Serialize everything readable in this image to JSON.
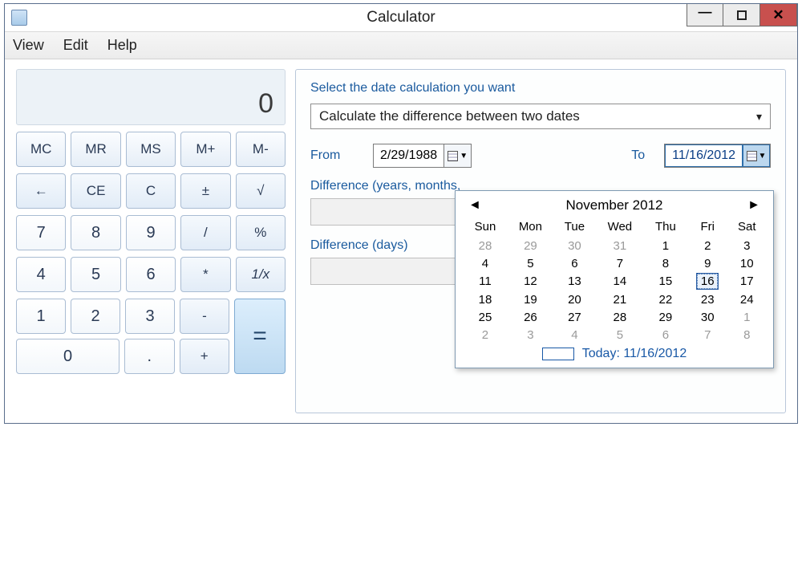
{
  "window": {
    "title": "Calculator"
  },
  "menu": {
    "view": "View",
    "edit": "Edit",
    "help": "Help"
  },
  "calc": {
    "display": "0",
    "mc": "MC",
    "mr": "MR",
    "ms": "MS",
    "mplus": "M+",
    "mminus": "M-",
    "back": "←",
    "ce": "CE",
    "c": "C",
    "pm": "±",
    "sqrt": "√",
    "n7": "7",
    "n8": "8",
    "n9": "9",
    "div": "/",
    "pct": "%",
    "n4": "4",
    "n5": "5",
    "n6": "6",
    "mul": "*",
    "inv": "1/x",
    "n1": "1",
    "n2": "2",
    "n3": "3",
    "sub": "-",
    "eq": "=",
    "n0": "0",
    "dot": ".",
    "add": "+"
  },
  "datecalc": {
    "prompt": "Select the date calculation you want",
    "mode": "Calculate the difference between two dates",
    "from_lbl": "From",
    "to_lbl": "To",
    "from_val": "2/29/1988",
    "to_val": "11/16/2012",
    "diff_ymwd_lbl": "Difference (years, months,",
    "diff_days_lbl": "Difference (days)"
  },
  "calendar": {
    "title": "November 2012",
    "dow": [
      "Sun",
      "Mon",
      "Tue",
      "Wed",
      "Thu",
      "Fri",
      "Sat"
    ],
    "weeks": [
      [
        {
          "d": "28",
          "o": true
        },
        {
          "d": "29",
          "o": true
        },
        {
          "d": "30",
          "o": true
        },
        {
          "d": "31",
          "o": true
        },
        {
          "d": "1"
        },
        {
          "d": "2"
        },
        {
          "d": "3"
        }
      ],
      [
        {
          "d": "4"
        },
        {
          "d": "5"
        },
        {
          "d": "6"
        },
        {
          "d": "7"
        },
        {
          "d": "8"
        },
        {
          "d": "9"
        },
        {
          "d": "10"
        }
      ],
      [
        {
          "d": "11"
        },
        {
          "d": "12"
        },
        {
          "d": "13"
        },
        {
          "d": "14"
        },
        {
          "d": "15"
        },
        {
          "d": "16",
          "sel": true
        },
        {
          "d": "17"
        }
      ],
      [
        {
          "d": "18"
        },
        {
          "d": "19"
        },
        {
          "d": "20"
        },
        {
          "d": "21"
        },
        {
          "d": "22"
        },
        {
          "d": "23"
        },
        {
          "d": "24"
        }
      ],
      [
        {
          "d": "25"
        },
        {
          "d": "26"
        },
        {
          "d": "27"
        },
        {
          "d": "28"
        },
        {
          "d": "29"
        },
        {
          "d": "30"
        },
        {
          "d": "1",
          "o": true
        }
      ],
      [
        {
          "d": "2",
          "o": true
        },
        {
          "d": "3",
          "o": true
        },
        {
          "d": "4",
          "o": true
        },
        {
          "d": "5",
          "o": true
        },
        {
          "d": "6",
          "o": true
        },
        {
          "d": "7",
          "o": true
        },
        {
          "d": "8",
          "o": true
        }
      ]
    ],
    "today_label": "Today: 11/16/2012"
  }
}
